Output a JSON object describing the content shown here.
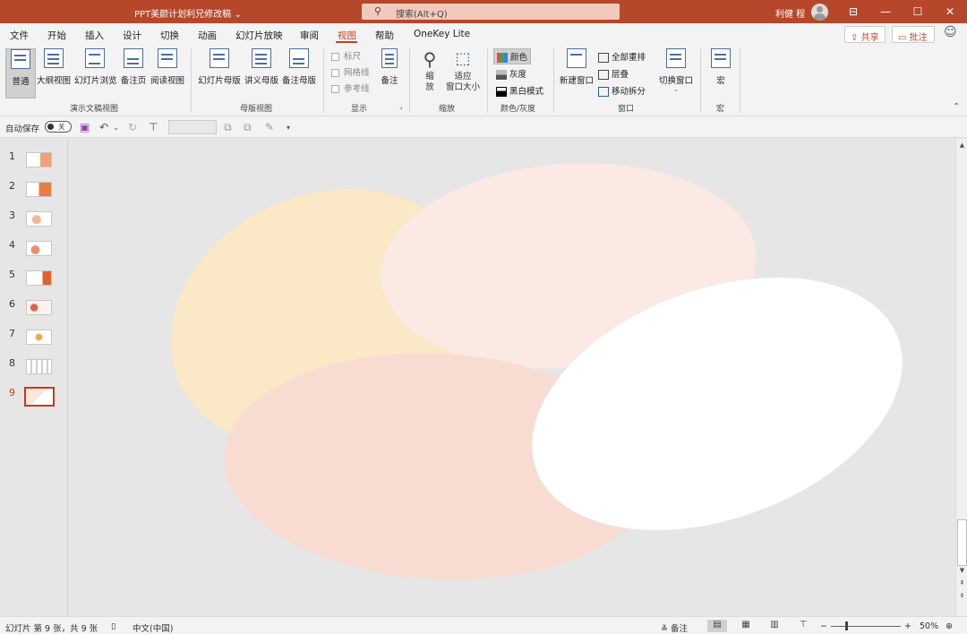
{
  "titlebar": {
    "doc_title": "PPT美颜计划利兄修改稿 ⌄",
    "search_icon": "search-icon",
    "search_text": "搜索(Alt+Q)",
    "user_name": "利健 程",
    "controls": {
      "ribbon_display": "⊟",
      "minimize": "—",
      "maximize": "☐",
      "close": "✕"
    }
  },
  "tabs": [
    {
      "label": "文件"
    },
    {
      "label": "开始"
    },
    {
      "label": "插入"
    },
    {
      "label": "设计"
    },
    {
      "label": "切换"
    },
    {
      "label": "动画"
    },
    {
      "label": "幻灯片放映"
    },
    {
      "label": "审阅"
    },
    {
      "label": "视图",
      "active": true
    },
    {
      "label": "帮助"
    },
    {
      "label": "OneKey Lite"
    }
  ],
  "share_button": "共享",
  "comment_button": "批注",
  "ribbon": {
    "groups": {
      "presentation_views": "演示文稿视图",
      "master_views": "母版视图",
      "show": "显示",
      "zoom": "缩放",
      "color": "颜色/灰度",
      "window": "窗口",
      "macros": "宏"
    },
    "buttons": {
      "normal": "普通",
      "outline": "大纲视图",
      "slide_sorter": "幻灯片浏览",
      "notes_page": "备注页",
      "reading_view": "阅读视图",
      "slide_master": "幻灯片母版",
      "handout_master": "讲义母版",
      "notes_master": "备注母版",
      "ruler": "标尺",
      "gridlines": "网格线",
      "guides": "参考线",
      "notes": "备注",
      "zoom_line1": "缩",
      "zoom_line2": "放",
      "fit_line1": "适应",
      "fit_line2": "窗口大小",
      "color": "颜色",
      "grayscale": "灰度",
      "black_white": "黑白模式",
      "new_window": "新建窗口",
      "arrange_all": "全部重排",
      "cascade": "层叠",
      "move_split": "移动拆分",
      "switch_windows": "切换窗口",
      "macros": "宏"
    }
  },
  "qat": {
    "autosave_label": "自动保存",
    "autosave_state": "关"
  },
  "slides": [
    {
      "num": "1"
    },
    {
      "num": "2"
    },
    {
      "num": "3"
    },
    {
      "num": "4"
    },
    {
      "num": "5"
    },
    {
      "num": "6"
    },
    {
      "num": "7"
    },
    {
      "num": "8"
    },
    {
      "num": "9",
      "selected": true
    }
  ],
  "slide_shapes": [
    {
      "name": "yellow-ellipse",
      "color": "#fbe8c7"
    },
    {
      "name": "blush-ellipse",
      "color": "#fbe9e3"
    },
    {
      "name": "pink-ellipse",
      "color": "#f8dcd2"
    },
    {
      "name": "white-ellipse",
      "color": "#ffffff"
    }
  ],
  "statusbar": {
    "slide_info": "幻灯片 第 9 张，共 9 张",
    "language": "中文(中国)",
    "notes": "备注",
    "zoom": "50%"
  }
}
